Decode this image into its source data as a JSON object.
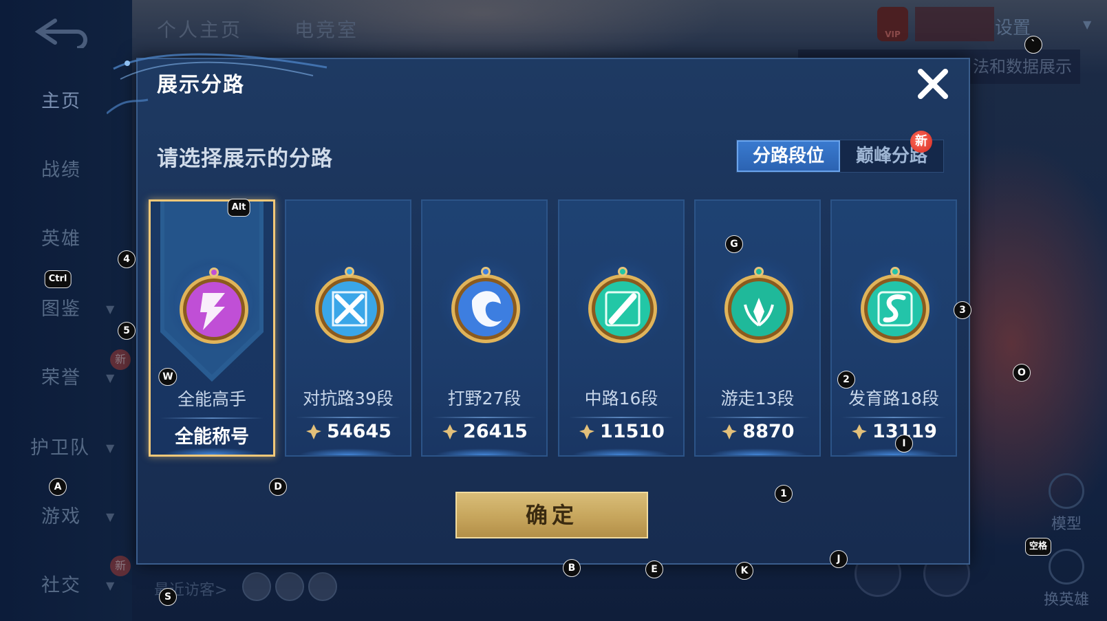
{
  "background": {
    "nav_items": [
      {
        "label": "主页",
        "active": true
      },
      {
        "label": "战绩"
      },
      {
        "label": "英雄"
      },
      {
        "label": "图鉴"
      },
      {
        "label": "荣誉"
      },
      {
        "label": "护卫队"
      },
      {
        "label": "游戏"
      },
      {
        "label": "社交"
      }
    ],
    "nav_new_badge": "新",
    "top_tabs": [
      "个人主页",
      "电竞室"
    ],
    "settings_label": "设置",
    "strip_text": "法和数据展示",
    "vip_label": "VIP",
    "right_buttons": [
      "模型",
      "换英雄"
    ],
    "visitors_label": "最近访客>"
  },
  "dialog": {
    "title": "展示分路",
    "subtitle": "请选择展示的分路",
    "tabs": [
      {
        "label": "分路段位",
        "active": true
      },
      {
        "label": "巅峰分路",
        "active": false
      }
    ],
    "tab_new_badge": "新",
    "confirm_label": "确定",
    "cards": [
      {
        "name": "全能高手",
        "value": "全能称号",
        "selected": true,
        "color": "#c04fd6",
        "icon": "all-round-emblem-icon"
      },
      {
        "name": "对抗路39段",
        "value": "54645",
        "selected": false,
        "color": "#3aa6e8",
        "icon": "clash-lane-emblem-icon"
      },
      {
        "name": "打野27段",
        "value": "26415",
        "selected": false,
        "color": "#3d7ee0",
        "icon": "jungle-emblem-icon"
      },
      {
        "name": "中路16段",
        "value": "11510",
        "selected": false,
        "color": "#22c7a6",
        "icon": "mid-lane-emblem-icon"
      },
      {
        "name": "游走13段",
        "value": "8870",
        "selected": false,
        "color": "#1fb99a",
        "icon": "roam-emblem-icon"
      },
      {
        "name": "发育路18段",
        "value": "13119",
        "selected": false,
        "color": "#23c4a9",
        "icon": "farm-lane-emblem-icon"
      }
    ]
  },
  "overlay_hints": [
    {
      "label": "`"
    },
    {
      "label": "Alt"
    },
    {
      "label": "4"
    },
    {
      "label": "Ctrl"
    },
    {
      "label": "5"
    },
    {
      "label": "W"
    },
    {
      "label": "G"
    },
    {
      "label": "3"
    },
    {
      "label": "O"
    },
    {
      "label": "2"
    },
    {
      "label": "I"
    },
    {
      "label": "A"
    },
    {
      "label": "D"
    },
    {
      "label": "1"
    },
    {
      "label": "J"
    },
    {
      "label": "B"
    },
    {
      "label": "E"
    },
    {
      "label": "K"
    },
    {
      "label": "S"
    },
    {
      "label": "空格"
    }
  ]
}
